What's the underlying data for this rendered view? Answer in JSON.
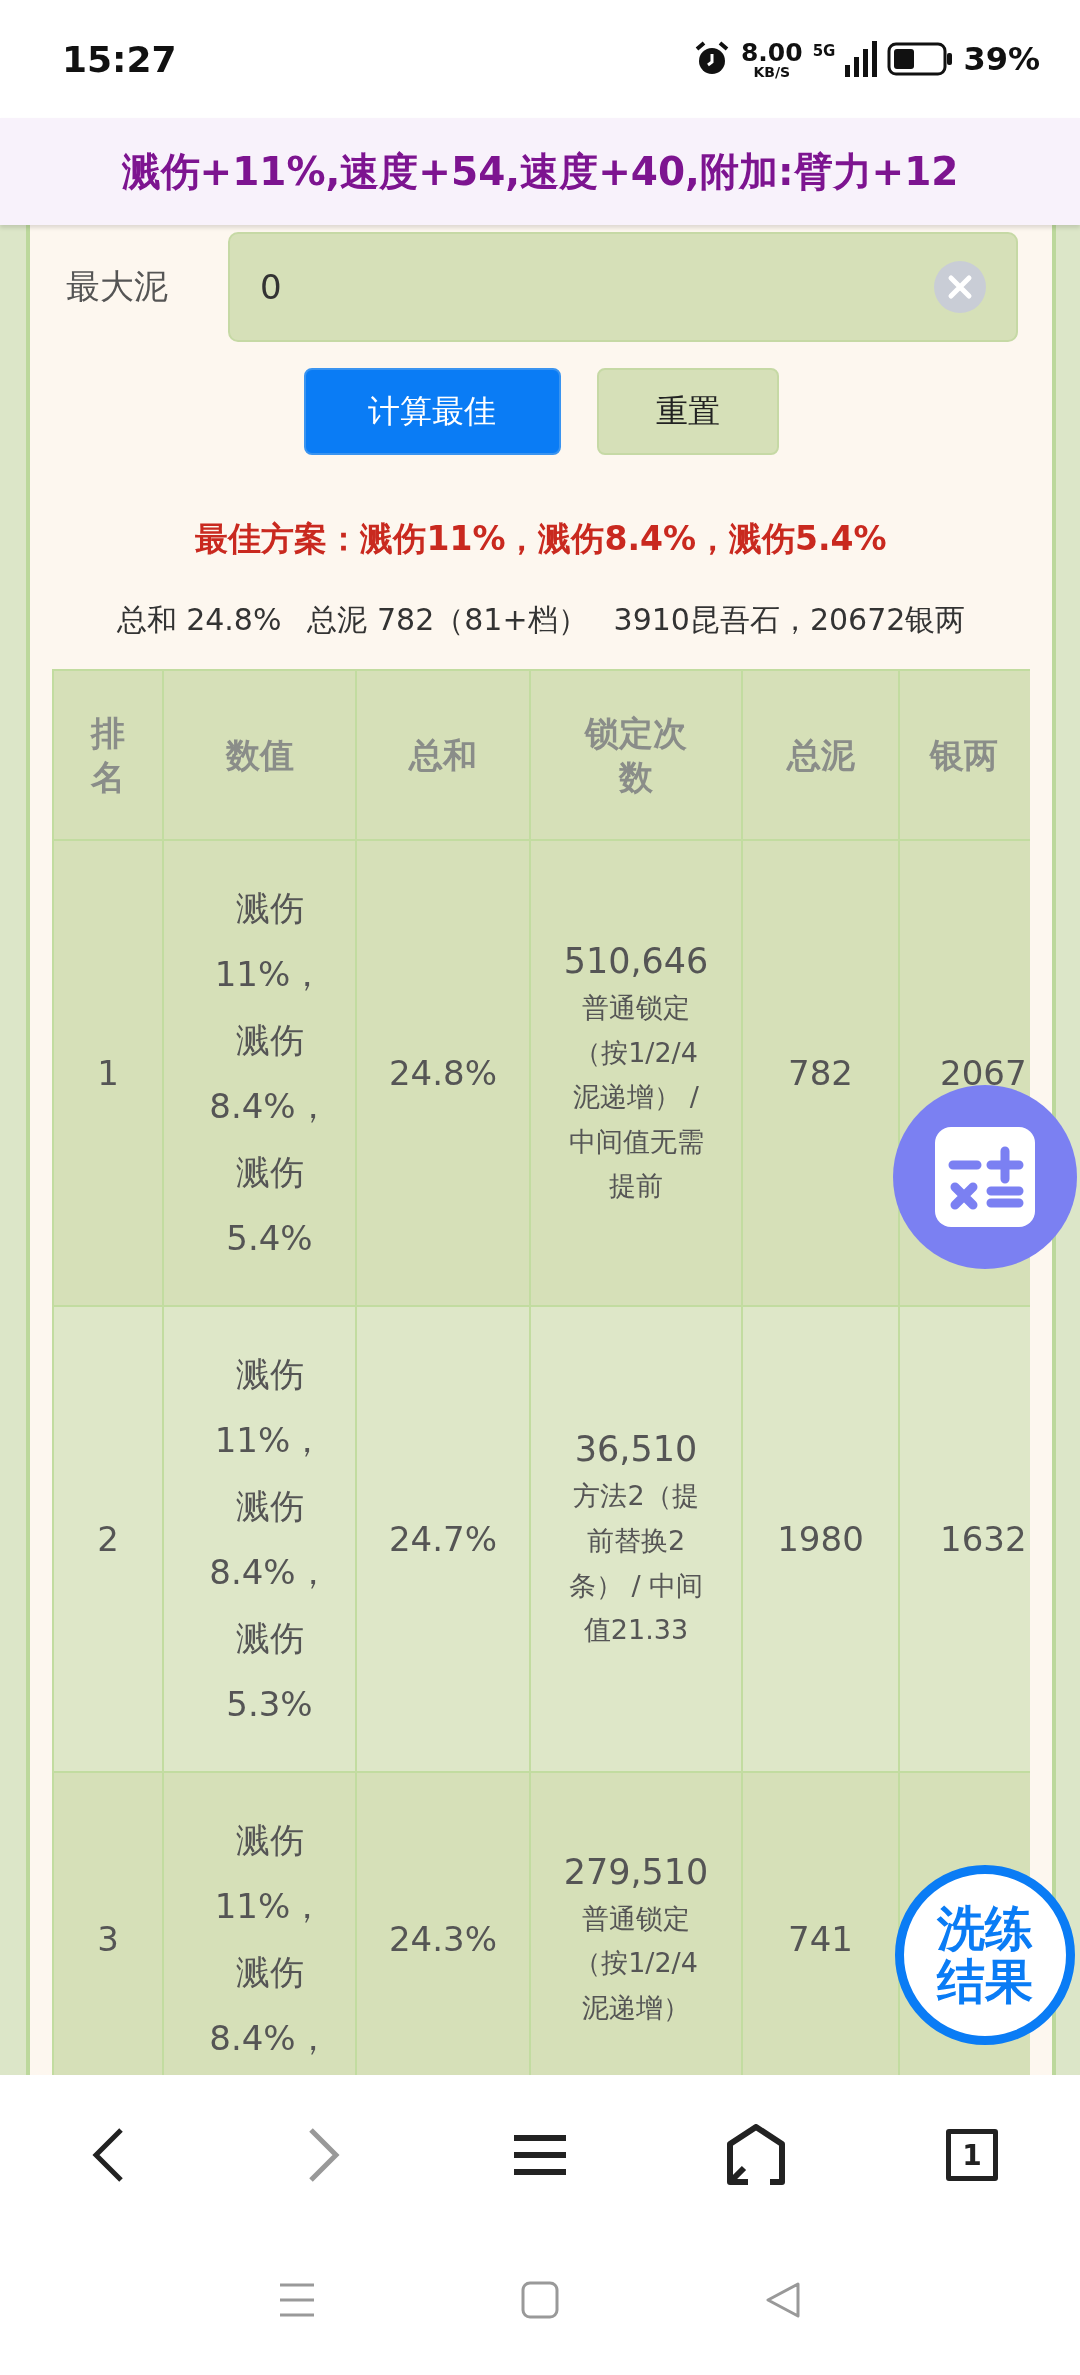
{
  "status_bar": {
    "time": "15:27",
    "net_speed": "8.00",
    "net_unit": "KB/S",
    "network": "5G",
    "battery": "39%"
  },
  "banner": {
    "text": "溅伤+11%,速度+54,速度+40,附加:臂力+12"
  },
  "field": {
    "label": "最大泥",
    "value": "0"
  },
  "buttons": [
    {
      "label": "计算最佳",
      "kind": "primary"
    },
    {
      "label": "重置",
      "kind": "secondary"
    }
  ],
  "best_plan": "最佳方案：溅伤11%，溅伤8.4%，溅伤5.4%",
  "summary": [
    "总和 24.8%",
    "总泥 782（81+档）",
    "3910昆吾石，20672银两"
  ],
  "table": {
    "columns": [
      "排名",
      "数值",
      "总和",
      "锁定次数",
      "总泥",
      "银两"
    ],
    "rows": [
      {
        "rank": "1",
        "values": "溅伤 11%，溅伤 8.4%，溅伤 5.4%",
        "sum": "24.8%",
        "lock_count": "510,646",
        "lock_note": "普通锁定（按1/2/4泥递增） / 中间值无需提前",
        "total_mud": "782",
        "silver": "2067"
      },
      {
        "rank": "2",
        "values": "溅伤 11%，溅伤 8.4%，溅伤 5.3%",
        "sum": "24.7%",
        "lock_count": "36,510",
        "lock_note": "方法2（提前替换2条） / 中间值21.33",
        "total_mud": "1980",
        "silver": "1632"
      },
      {
        "rank": "3",
        "values": "溅伤 11%，溅伤 8.4%，",
        "sum": "24.3%",
        "lock_count": "279,510",
        "lock_note": "普通锁定（按1/2/4泥递增）",
        "total_mud": "741"
      }
    ]
  },
  "floating_buttons": [
    {
      "kind": "calculator"
    },
    {
      "kind": "text",
      "label": "洗练结果"
    }
  ],
  "browser_nav": {
    "forward_disabled": true,
    "tab_count": "1"
  }
}
